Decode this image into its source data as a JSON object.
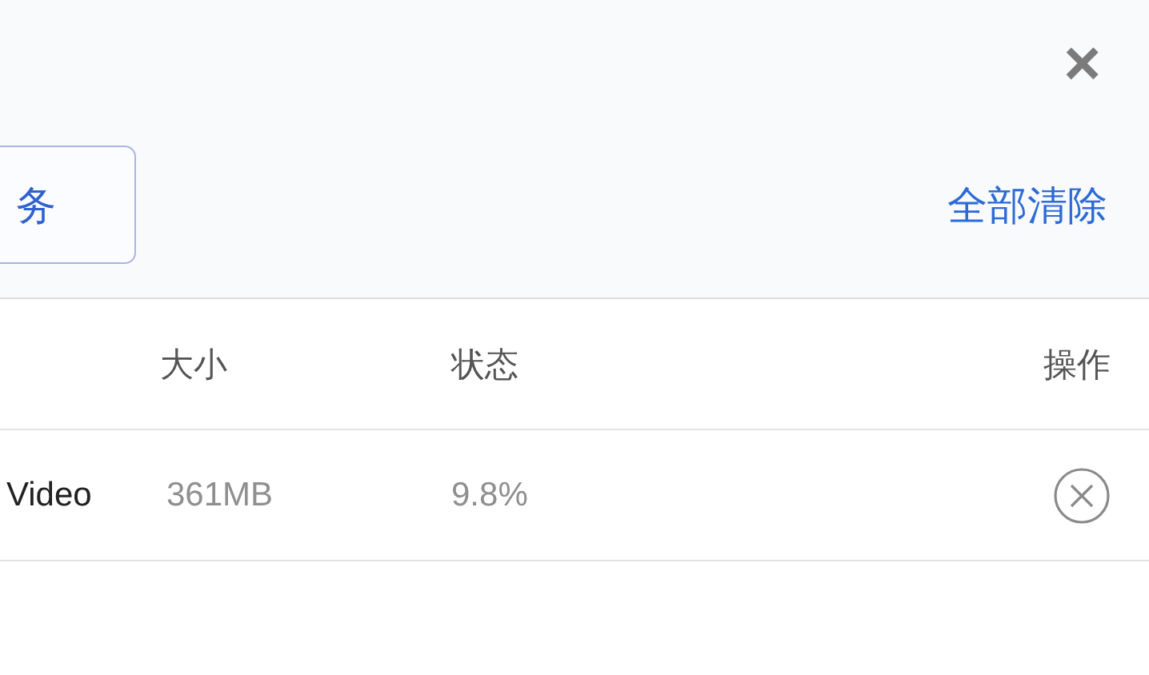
{
  "header": {
    "close": "×",
    "task_button": "务",
    "clear_all": "全部清除"
  },
  "table": {
    "columns": [
      "大小",
      "状态",
      "操作"
    ],
    "rows": [
      {
        "column_1": "Video",
        "size": "361MB",
        "status": "9.8%"
      }
    ]
  }
}
